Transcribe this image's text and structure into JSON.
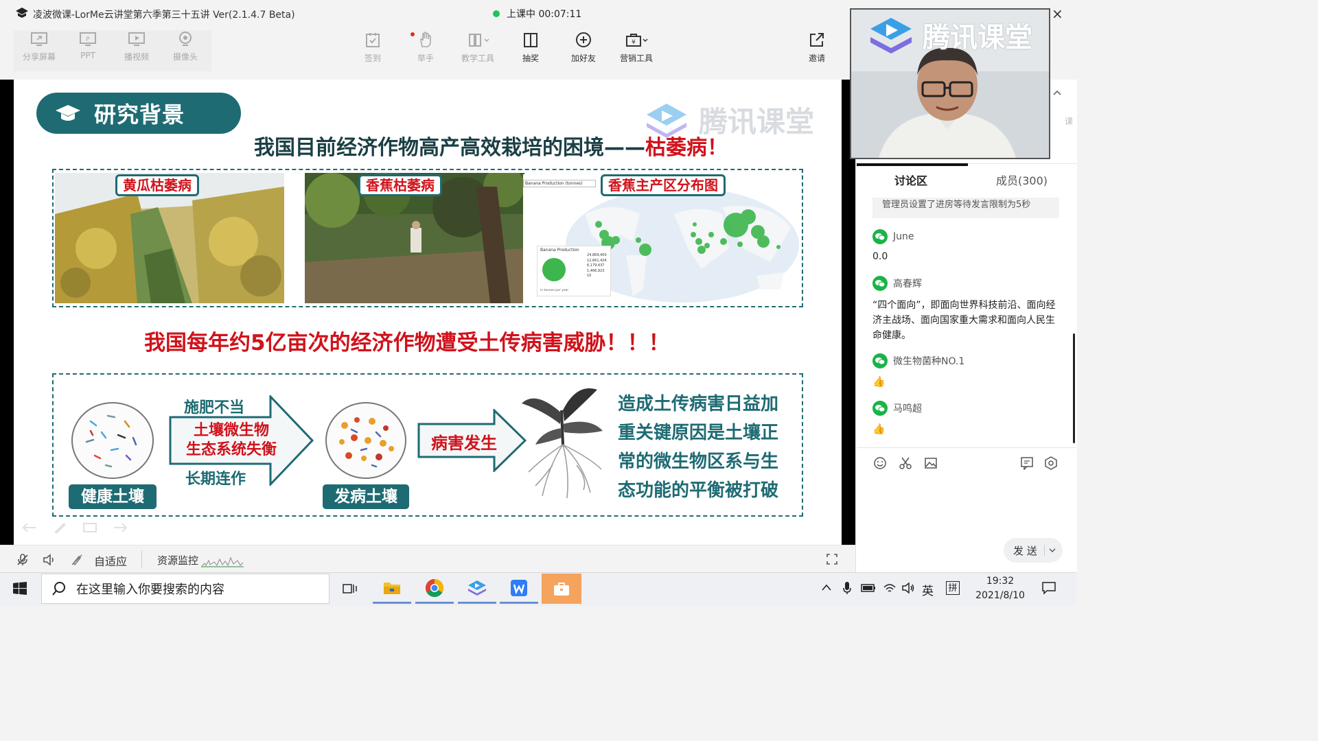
{
  "window": {
    "title": "凌波微课-LorMe云讲堂第六季第三十五讲 Ver(2.1.4.7 Beta)",
    "class_status": "上课中 00:07:11",
    "close_glyph": "×"
  },
  "toolbar": {
    "left": [
      {
        "label": "分享屏幕",
        "icon": "share-screen-icon"
      },
      {
        "label": "PPT",
        "icon": "ppt-icon"
      },
      {
        "label": "播视频",
        "icon": "play-video-icon"
      },
      {
        "label": "摄像头",
        "icon": "camera-icon"
      }
    ],
    "center": [
      {
        "label": "签到",
        "icon": "checkin-icon"
      },
      {
        "label": "举手",
        "icon": "hand-icon"
      },
      {
        "label": "教学工具",
        "icon": "teaching-tools-icon"
      },
      {
        "label": "抽奖",
        "icon": "lottery-icon"
      },
      {
        "label": "加好友",
        "icon": "add-friend-icon"
      },
      {
        "label": "营销工具",
        "icon": "marketing-tools-icon"
      }
    ],
    "invite": "邀请"
  },
  "slide": {
    "section_badge": "研究背景",
    "watermark": "腾讯课堂",
    "headline_part1": "我国目前经济作物高产高效栽培的困境——",
    "headline_part2": "枯萎病！",
    "captions": [
      "黄瓜枯萎病",
      "香蕉枯萎病",
      "香蕉主产区分布图"
    ],
    "map_dropdown": "Banana Production (tonnes)",
    "map_legend_title": "Banana Production",
    "map_legend_values": [
      "24,869,400",
      "12,661,426",
      "6,179,437",
      "1,466,923",
      "10"
    ],
    "map_legend_unit": "in tonnes per year",
    "threat_line": "我国每年约5亿亩次的经济作物遭受土传病害威胁！！！",
    "arrow1": {
      "top": "施肥不当",
      "mid1": "土壤微生物",
      "mid2": "生态系统失衡",
      "bottom": "长期连作"
    },
    "healthy_soil": "健康土壤",
    "diseased_soil": "发病土壤",
    "disease_occurs": "病害发生",
    "conclusion": [
      "造成土传病害日益加",
      "重关键原因是土壤正",
      "常的微生物区系与生",
      "态功能的平衡被打破"
    ]
  },
  "bottombar": {
    "fit": "自适应",
    "monitor": "资源监控"
  },
  "side": {
    "video_watermark": "腾讯课堂",
    "tabs": [
      "讨论区",
      "成员(300)"
    ],
    "notice": "管理员设置了进房等待发言限制为5秒",
    "messages": [
      {
        "name": "June",
        "text": "0.0"
      },
      {
        "name": "高春辉",
        "text": "“四个面向”，即面向世界科技前沿、面向经济主战场、面向国家重大需求和面向人民生命健康。"
      },
      {
        "name": "微生物菌种NO.1",
        "text": "👍"
      },
      {
        "name": "马鸣超",
        "text": "👍"
      }
    ],
    "send": "发 送"
  },
  "taskbar": {
    "search_placeholder": "在这里输入你要搜索的内容",
    "ime_lang": "英",
    "ime_mode": "拼",
    "time": "19:32",
    "date": "2021/8/10"
  },
  "colors": {
    "teal": "#1e6b73",
    "red": "#d0121b",
    "green": "#19b447"
  }
}
